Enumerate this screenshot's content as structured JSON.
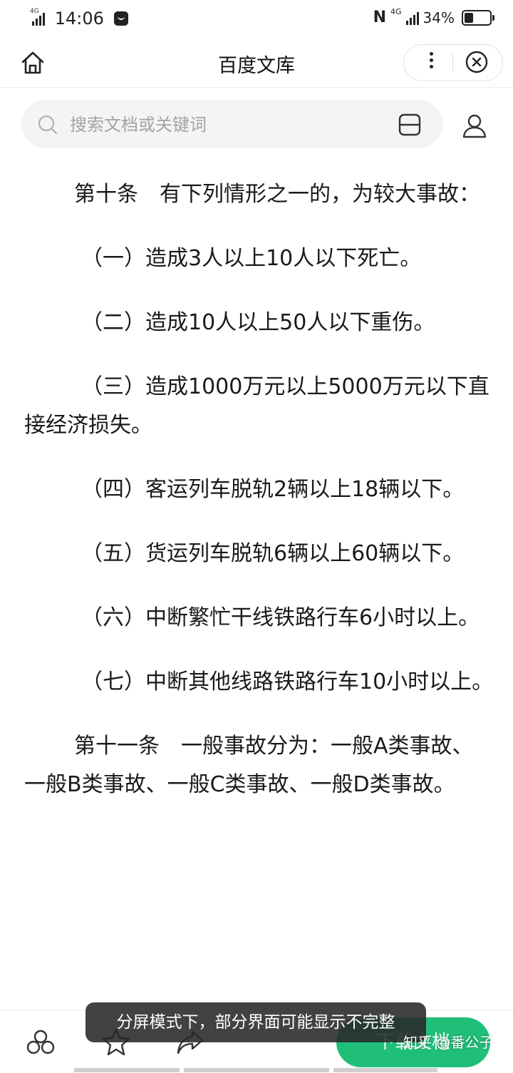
{
  "status_bar": {
    "network_left": "4G",
    "time": "14:06",
    "network_right": "4G",
    "battery": "34%",
    "battery_level": 0.34
  },
  "header": {
    "title": "百度文库"
  },
  "search": {
    "placeholder": "搜索文档或关键词"
  },
  "document": {
    "paragraphs": [
      "第十条　有下列情形之一的，为较大事故：",
      "（一）造成3人以上10人以下死亡。",
      "（二）造成10人以上50人以下重伤。",
      "（三）造成1000万元以上5000万元以下直接经济损失。",
      "（四）客运列车脱轨2辆以上18辆以下。",
      "（五）货运列车脱轨6辆以上60辆以下。",
      "（六）中断繁忙干线铁路行车6小时以上。",
      "（七）中断其他线路铁路行车10小时以上。",
      "第十一条　一般事故分为：一般A类事故、一般B类事故、一般C类事故、一般D类事故。"
    ]
  },
  "toast": {
    "text": "分屏模式下，部分界面可能显示不完整"
  },
  "bottom_bar": {
    "download_label": "下载文档"
  },
  "watermark": "知乎 @番公子",
  "colors": {
    "accent": "#1fbf78",
    "toast_bg": "#282828",
    "search_bg": "#f4f4f4"
  },
  "icons": {
    "home": "home-icon",
    "more": "more-vertical-icon",
    "close": "close-circle-icon",
    "search": "search-icon",
    "scan": "scan-icon",
    "user": "user-icon",
    "share_circles": "circles-icon",
    "favorite": "star-icon",
    "forward": "share-arrow-icon"
  }
}
